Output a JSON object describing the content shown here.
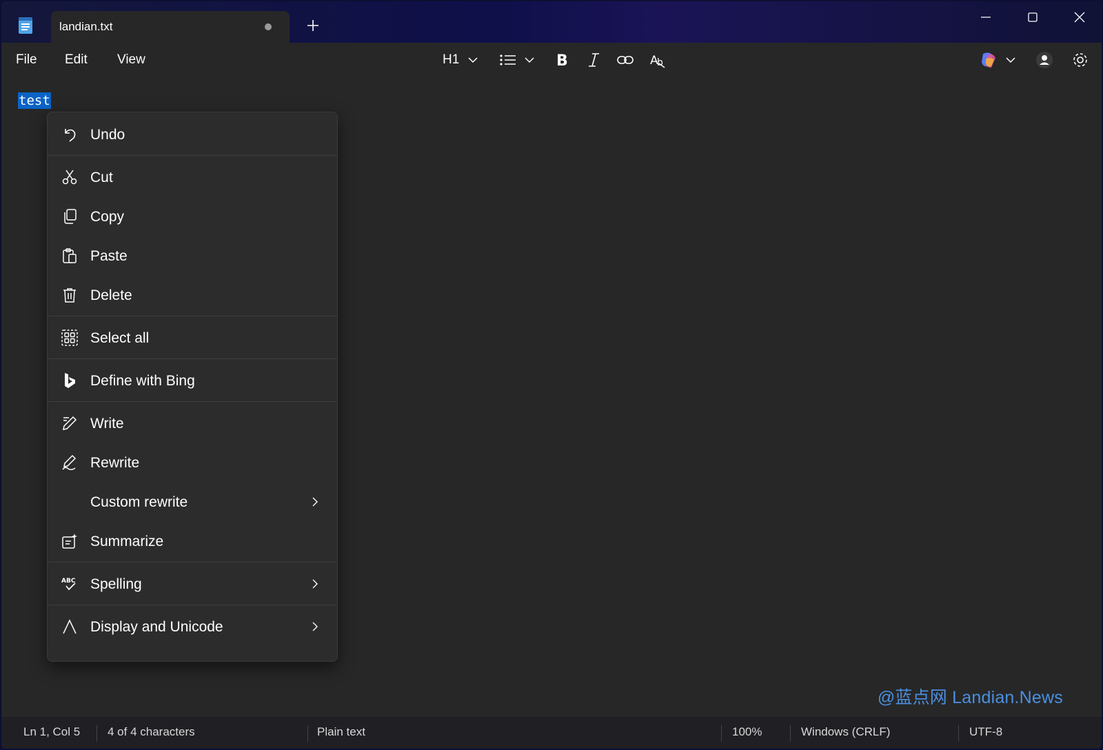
{
  "tab": {
    "title": "landian.txt"
  },
  "menu": {
    "file": "File",
    "edit": "Edit",
    "view": "View"
  },
  "toolbar": {
    "heading": "H1"
  },
  "editor": {
    "selected_text": "test"
  },
  "context_menu": {
    "undo": "Undo",
    "cut": "Cut",
    "copy": "Copy",
    "paste": "Paste",
    "delete": "Delete",
    "select_all": "Select all",
    "define_with_bing": "Define with Bing",
    "write": "Write",
    "rewrite": "Rewrite",
    "custom_rewrite": "Custom rewrite",
    "summarize": "Summarize",
    "spelling": "Spelling",
    "display_unicode": "Display and Unicode"
  },
  "status": {
    "position": "Ln 1, Col 5",
    "characters": "4 of 4 characters",
    "format": "Plain text",
    "zoom": "100%",
    "line_ending": "Windows (CRLF)",
    "encoding": "UTF-8"
  },
  "watermark": "@蓝点网 Landian.News",
  "colors": {
    "selection": "#0a63c7",
    "watermark": "#4a8fe0"
  }
}
